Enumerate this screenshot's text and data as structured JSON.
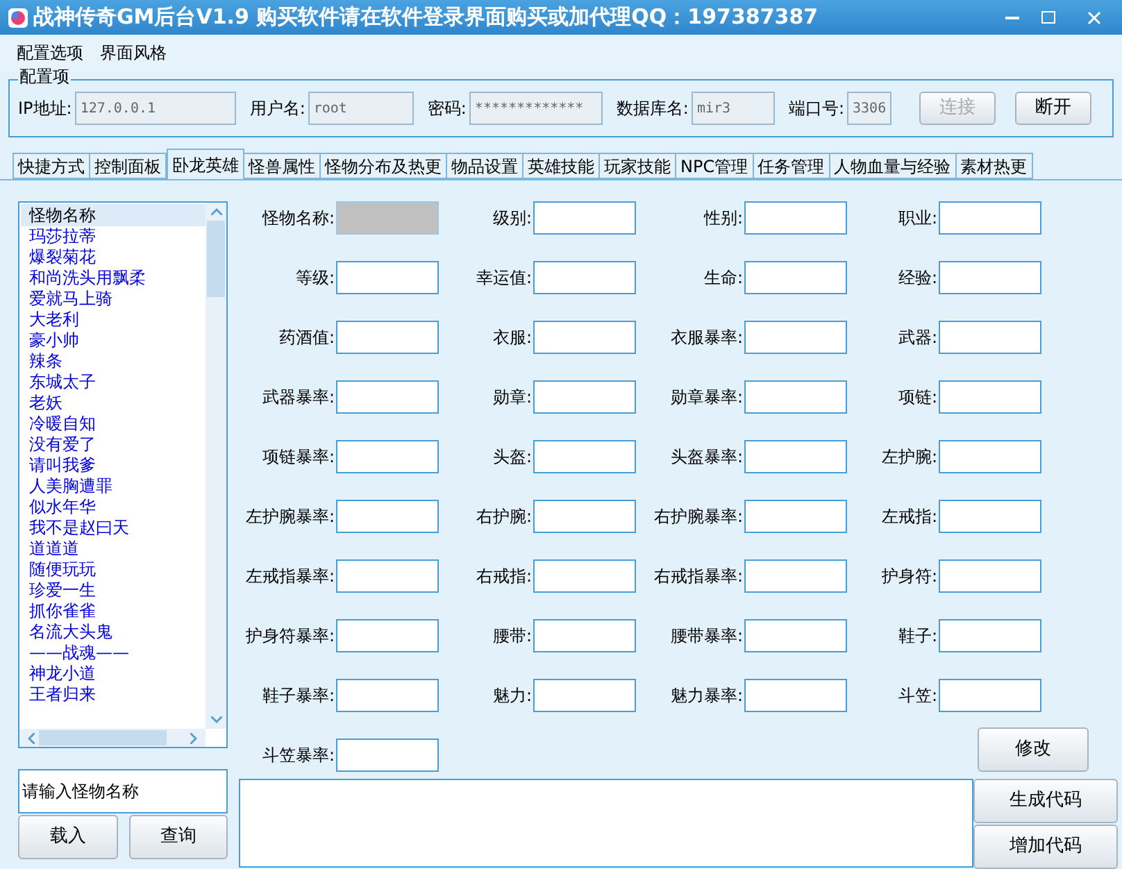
{
  "window": {
    "title": "战神传奇GM后台V1.9   购买软件请在软件登录界面购买或加代理QQ：197387387"
  },
  "menu": [
    "配置选项",
    "界面风格"
  ],
  "config": {
    "title": "配置项",
    "fields": [
      {
        "label": "IP地址:",
        "value": "127.0.0.1"
      },
      {
        "label": "用户名:",
        "value": "root"
      },
      {
        "label": "密码:",
        "value": "*************"
      },
      {
        "label": "数据库名:",
        "value": "mir3"
      },
      {
        "label": "端口号:",
        "value": "3306"
      }
    ],
    "buttons": [
      {
        "label": "连接",
        "disabled": true
      },
      {
        "label": "断开",
        "disabled": false
      }
    ]
  },
  "tabs": [
    {
      "label": "快捷方式",
      "selected": false
    },
    {
      "label": "控制面板",
      "selected": false
    },
    {
      "label": "卧龙英雄",
      "selected": true
    },
    {
      "label": "怪兽属性",
      "selected": false
    },
    {
      "label": "怪物分布及热更",
      "selected": false
    },
    {
      "label": "物品设置",
      "selected": false
    },
    {
      "label": "英雄技能",
      "selected": false
    },
    {
      "label": "玩家技能",
      "selected": false
    },
    {
      "label": "NPC管理",
      "selected": false
    },
    {
      "label": "任务管理",
      "selected": false
    },
    {
      "label": "人物血量与经验",
      "selected": false
    },
    {
      "label": "素材热更"
    }
  ],
  "monster_list": {
    "header": "怪物名称",
    "items": [
      "玛莎拉蒂",
      "爆裂菊花",
      "和尚洗头用飘柔",
      "爱就马上骑",
      "大老利",
      "豪小帅",
      "辣条",
      "东城太子",
      "老妖",
      "冷暖自知",
      "没有爱了",
      "请叫我爹",
      "人美胸遭罪",
      "似水年华",
      "我不是赵曰天",
      "道道道",
      "随便玩玩",
      "珍爱一生",
      "抓你雀雀",
      "名流大头鬼",
      "——战魂——",
      "神龙小道",
      "王者归来"
    ]
  },
  "search": {
    "placeholder": "请输入怪物名称"
  },
  "left_buttons": [
    "载入",
    "查询"
  ],
  "form_fields": [
    {
      "label": "怪物名称:",
      "disabled": true
    },
    {
      "label": "级别:",
      "disabled": false
    },
    {
      "label": "性别:",
      "disabled": false
    },
    {
      "label": "职业:",
      "disabled": false
    },
    {
      "label": "等级:",
      "disabled": false
    },
    {
      "label": "幸运值:",
      "disabled": false
    },
    {
      "label": "生命:",
      "disabled": false
    },
    {
      "label": "经验:",
      "disabled": false
    },
    {
      "label": "药酒值:",
      "disabled": false
    },
    {
      "label": "衣服:",
      "disabled": false
    },
    {
      "label": "衣服暴率:",
      "disabled": false
    },
    {
      "label": "武器:",
      "disabled": false
    },
    {
      "label": "武器暴率:",
      "disabled": false
    },
    {
      "label": "勋章:",
      "disabled": false
    },
    {
      "label": "勋章暴率:",
      "disabled": false
    },
    {
      "label": "项链:",
      "disabled": false
    },
    {
      "label": "项链暴率:",
      "disabled": false
    },
    {
      "label": "头盔:",
      "disabled": false
    },
    {
      "label": "头盔暴率:",
      "disabled": false
    },
    {
      "label": "左护腕:",
      "disabled": false
    },
    {
      "label": "左护腕暴率:",
      "disabled": false
    },
    {
      "label": "右护腕:",
      "disabled": false
    },
    {
      "label": "右护腕暴率:",
      "disabled": false
    },
    {
      "label": "左戒指:",
      "disabled": false
    },
    {
      "label": "左戒指暴率:",
      "disabled": false
    },
    {
      "label": "右戒指:",
      "disabled": false
    },
    {
      "label": "右戒指暴率:",
      "disabled": false
    },
    {
      "label": "护身符:",
      "disabled": false
    },
    {
      "label": "护身符暴率:",
      "disabled": false
    },
    {
      "label": "腰带:",
      "disabled": false
    },
    {
      "label": "腰带暴率:",
      "disabled": false
    },
    {
      "label": "鞋子:",
      "disabled": false
    },
    {
      "label": "鞋子暴率:",
      "disabled": false
    },
    {
      "label": "魅力:",
      "disabled": false
    },
    {
      "label": "魅力暴率:",
      "disabled": false
    },
    {
      "label": "斗笠:",
      "disabled": false
    },
    {
      "label": "斗笠暴率:",
      "disabled": false
    }
  ],
  "modify_button": "修改",
  "code_buttons": [
    "生成代码",
    "增加代码"
  ]
}
